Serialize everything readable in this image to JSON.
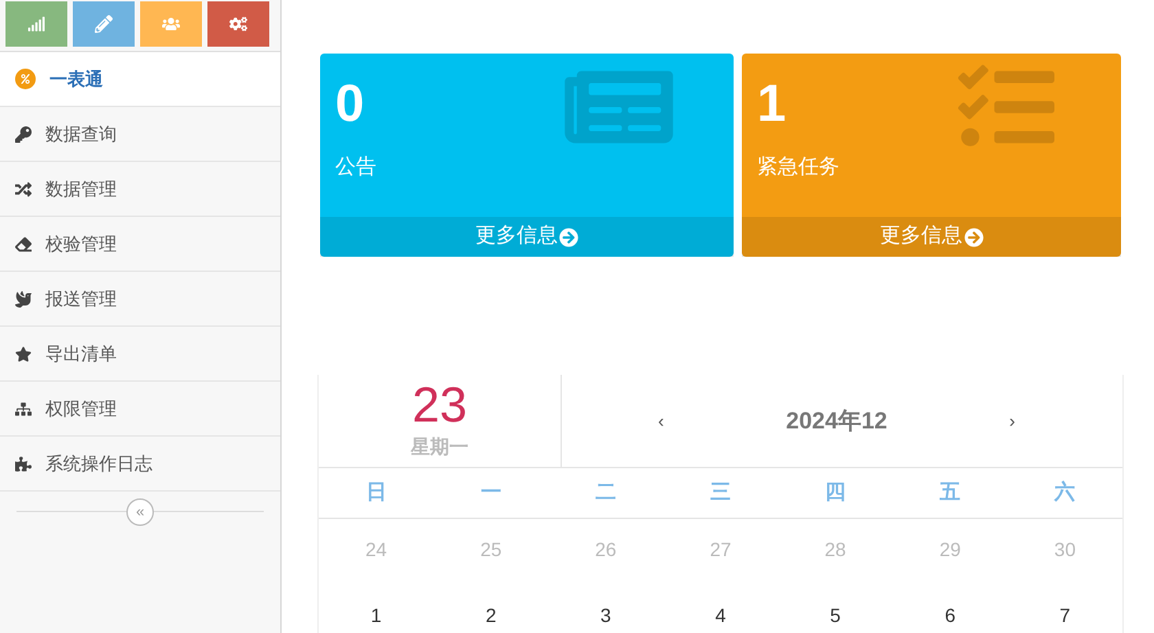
{
  "shortcuts": [
    {
      "kind": "chart",
      "color": "#87b87f"
    },
    {
      "kind": "pencil",
      "color": "#6fb3e0"
    },
    {
      "kind": "users",
      "color": "#ffb752"
    },
    {
      "kind": "cogs",
      "color": "#d15b47"
    }
  ],
  "menu": [
    {
      "label": "一表通",
      "kind": "badge",
      "selected": true
    },
    {
      "label": "数据查询",
      "kind": "key",
      "selected": false
    },
    {
      "label": "数据管理",
      "kind": "shuffle",
      "selected": false
    },
    {
      "label": "校验管理",
      "kind": "eraser",
      "selected": false
    },
    {
      "label": "报送管理",
      "kind": "squirrel",
      "selected": false
    },
    {
      "label": "导出清单",
      "kind": "star",
      "selected": false
    },
    {
      "label": "权限管理",
      "kind": "sitemap",
      "selected": false
    },
    {
      "label": "系统操作日志",
      "kind": "puzzle",
      "selected": false
    }
  ],
  "collapse_toggle": {
    "label": "«"
  },
  "stat_cards": [
    {
      "count": "0",
      "label": "公告",
      "link": "更多信息",
      "kind": "newspaper",
      "color": "#00c0ef"
    },
    {
      "count": "1",
      "label": "紧急任务",
      "kind": "tasks",
      "link": "更多信息",
      "color": "#f39c12"
    }
  ],
  "calendar": {
    "day": "23",
    "weekday": "星期一",
    "prev": "‹",
    "month": "2024年12",
    "next": "›",
    "weekdays": [
      "日",
      "一",
      "二",
      "三",
      "四",
      "五",
      "六"
    ],
    "days": [
      {
        "label": "24",
        "other_month": true
      },
      {
        "label": "25",
        "other_month": true
      },
      {
        "label": "26",
        "other_month": true
      },
      {
        "label": "27",
        "other_month": true
      },
      {
        "label": "28",
        "other_month": true
      },
      {
        "label": "29",
        "other_month": true
      },
      {
        "label": "30",
        "other_month": true
      },
      {
        "label": "1",
        "other_month": false
      },
      {
        "label": "2",
        "other_month": false
      },
      {
        "label": "3",
        "other_month": false
      },
      {
        "label": "4",
        "other_month": false
      },
      {
        "label": "5",
        "other_month": false
      },
      {
        "label": "6",
        "other_month": false
      },
      {
        "label": "7",
        "other_month": false
      }
    ]
  }
}
